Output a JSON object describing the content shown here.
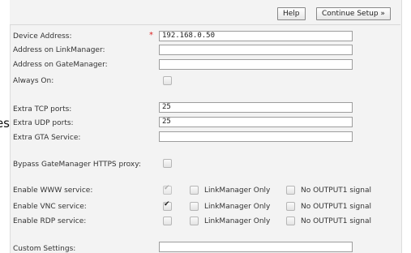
{
  "clipped_fragment": "es",
  "toolbar": {
    "help_label": "Help",
    "continue_label": "Continue Setup »"
  },
  "fields": {
    "device_address": {
      "label": "Device Address:",
      "value": "192.168.0.50",
      "required_mark": "*"
    },
    "linkmanager": {
      "label": "Address on LinkManager:",
      "value": ""
    },
    "gatemanager": {
      "label": "Address on GateManager:",
      "value": ""
    },
    "always_on": {
      "label": "Always On:",
      "checked": false
    },
    "tcp_ports": {
      "label": "Extra TCP ports:",
      "value": "25"
    },
    "udp_ports": {
      "label": "Extra UDP ports:",
      "value": "25"
    },
    "gta_service": {
      "label": "Extra GTA Service:",
      "value": ""
    },
    "bypass_proxy": {
      "label": "Bypass GateManager HTTPS proxy:",
      "checked": false
    },
    "custom_settings": {
      "label": "Custom Settings:",
      "value": ""
    }
  },
  "services": {
    "option_labels": {
      "linkmanager_only": "LinkManager Only",
      "no_output1": "No OUTPUT1 signal"
    },
    "www": {
      "label": "Enable WWW service:",
      "enabled": true,
      "enabled_disabled": true,
      "linkmanager_only": false,
      "no_output1": false
    },
    "vnc": {
      "label": "Enable VNC service:",
      "enabled": true,
      "linkmanager_only": false,
      "no_output1": false
    },
    "rdp": {
      "label": "Enable RDP service:",
      "enabled": false,
      "linkmanager_only": false,
      "no_output1": false
    }
  }
}
